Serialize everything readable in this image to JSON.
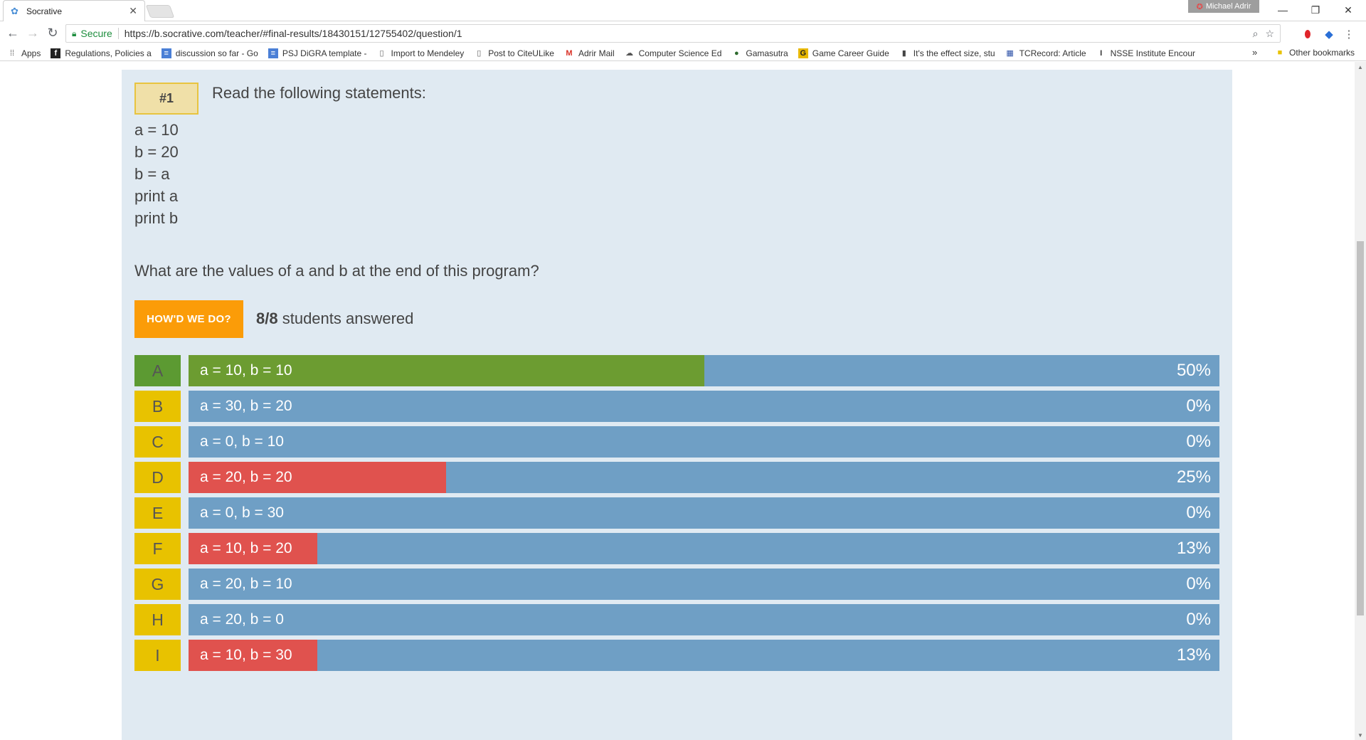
{
  "browser": {
    "tab_title": "Socrative",
    "profile_name": "Michael Adrir",
    "secure_label": "Secure",
    "url": "https://b.socrative.com/teacher/#final-results/18430151/12755402/question/1"
  },
  "bookmarks": [
    {
      "label": "Apps",
      "icon": "apps-icon"
    },
    {
      "label": "Regulations, Policies a",
      "icon": "f-icon"
    },
    {
      "label": "discussion so far - Go",
      "icon": "doc-icon"
    },
    {
      "label": "PSJ DiGRA template -",
      "icon": "doc-icon"
    },
    {
      "label": "Import to Mendeley",
      "icon": "page-icon"
    },
    {
      "label": "Post to CiteULike",
      "icon": "page-icon"
    },
    {
      "label": "Adrir Mail",
      "icon": "gmail-icon"
    },
    {
      "label": "Computer Science Ed",
      "icon": "cloud-icon"
    },
    {
      "label": "Gamasutra",
      "icon": "globe-icon"
    },
    {
      "label": "Game Career Guide",
      "icon": "gcg-icon"
    },
    {
      "label": "It's the effect size, stu",
      "icon": "lock-icon"
    },
    {
      "label": "TCRecord: Article",
      "icon": "bars-icon"
    },
    {
      "label": "NSSE Institute Encour",
      "icon": "i-icon"
    }
  ],
  "bookmarks_other": "Other bookmarks",
  "question": {
    "number": "#1",
    "intro": "Read the following statements:",
    "statements": [
      "a = 10",
      "b = 20",
      "b = a",
      "print a",
      "print b"
    ],
    "text": "What are the values of a and b at the end of this program?",
    "button_label": "HOW'D WE DO?",
    "answered_count": "8/8",
    "answered_text": "students answered"
  },
  "answers": [
    {
      "letter": "A",
      "label": "a = 10, b = 10",
      "percent": 50,
      "percent_label": "50%",
      "correct": true
    },
    {
      "letter": "B",
      "label": "a = 30, b = 20",
      "percent": 0,
      "percent_label": "0%",
      "correct": false
    },
    {
      "letter": "C",
      "label": "a = 0, b = 10",
      "percent": 0,
      "percent_label": "0%",
      "correct": false
    },
    {
      "letter": "D",
      "label": "a = 20, b = 20",
      "percent": 25,
      "percent_label": "25%",
      "correct": false
    },
    {
      "letter": "E",
      "label": "a = 0, b = 30",
      "percent": 0,
      "percent_label": "0%",
      "correct": false
    },
    {
      "letter": "F",
      "label": "a = 10, b = 20",
      "percent": 12.5,
      "percent_label": "13%",
      "correct": false
    },
    {
      "letter": "G",
      "label": "a = 20, b = 10",
      "percent": 0,
      "percent_label": "0%",
      "correct": false
    },
    {
      "letter": "H",
      "label": "a = 20, b = 0",
      "percent": 0,
      "percent_label": "0%",
      "correct": false
    },
    {
      "letter": "I",
      "label": "a = 10, b = 30",
      "percent": 12.5,
      "percent_label": "13%",
      "correct": false
    }
  ],
  "colors": {
    "correct_letter": "#5c9a32",
    "correct_fill": "#6c9c31",
    "wrong_letter": "#e8c200",
    "wrong_fill": "#e0524e",
    "bar_bg": "#6f9fc5",
    "button": "#fb9c08"
  }
}
